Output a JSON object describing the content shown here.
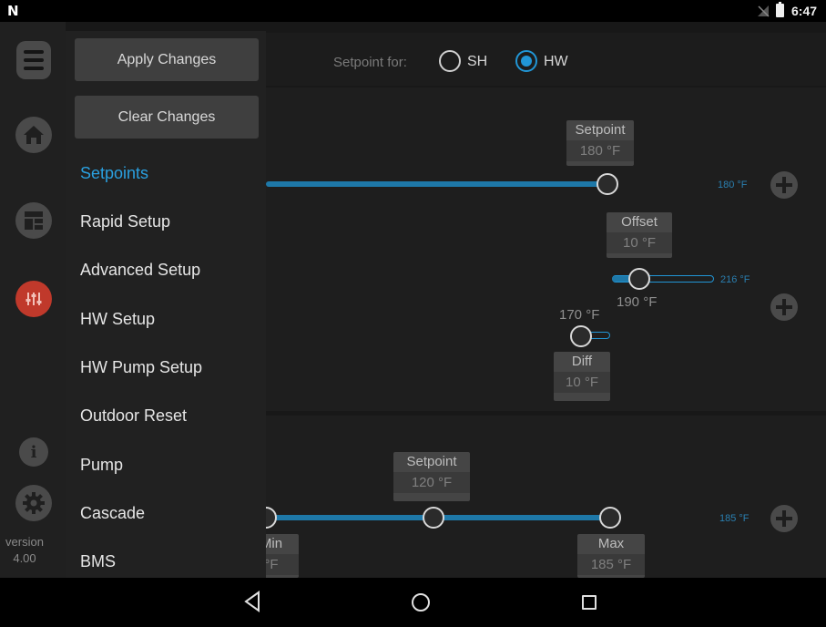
{
  "status": {
    "logo": "N",
    "time": "6:47"
  },
  "rail": {
    "version_label": "version",
    "version_number": "4.00"
  },
  "header": {
    "setpoint_for_label": "Setpoint for:",
    "options": [
      "SH",
      "HW"
    ],
    "selected": "HW"
  },
  "upper": {
    "setpoint": {
      "label": "Setpoint",
      "value": "180 °F",
      "max_label": "180 °F"
    },
    "offset": {
      "label": "Offset",
      "value": "10 °F",
      "max_label": "216 °F",
      "current": "190 °F"
    },
    "diff": {
      "label": "Diff",
      "value": "10 °F",
      "current": "170 °F"
    }
  },
  "lower": {
    "setpoint": {
      "label": "Setpoint",
      "value": "120 °F"
    },
    "min": {
      "label_partial": "Min",
      "value_partial": "°F"
    },
    "max": {
      "label": "Max",
      "value_partial": "185 °F",
      "max_label": "185 °F"
    }
  },
  "drawer": {
    "apply": "Apply Changes",
    "clear": "Clear Changes",
    "items": [
      "Setpoints",
      "Rapid Setup",
      "Advanced Setup",
      "HW Setup",
      "HW Pump Setup",
      "Outdoor Reset",
      "Pump",
      "Cascade",
      "BMS"
    ],
    "active": "Setpoints"
  },
  "colors": {
    "accent": "#2196d6",
    "track": "#1e78a8",
    "background": "#181818"
  }
}
